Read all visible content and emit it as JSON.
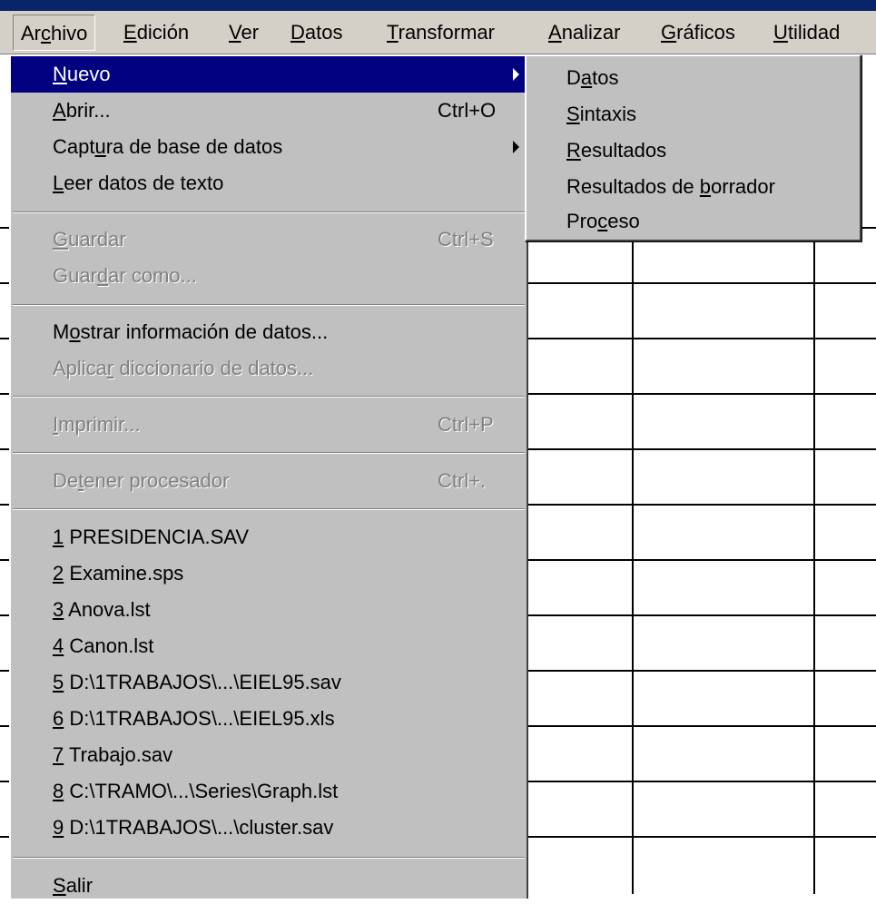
{
  "menubar": {
    "items": [
      {
        "pre": "Ar",
        "key": "c",
        "post": "hivo"
      },
      {
        "pre": "",
        "key": "E",
        "post": "dición"
      },
      {
        "pre": "",
        "key": "V",
        "post": "er"
      },
      {
        "pre": "",
        "key": "D",
        "post": "atos"
      },
      {
        "pre": "",
        "key": "T",
        "post": "ransformar"
      },
      {
        "pre": "",
        "key": "A",
        "post": "nalizar"
      },
      {
        "pre": "",
        "key": "G",
        "post": "ráficos"
      },
      {
        "pre": "",
        "key": "U",
        "post": "tilidad"
      }
    ]
  },
  "file_menu": {
    "nuevo": {
      "pre": "",
      "key": "N",
      "post": "uevo"
    },
    "abrir": {
      "pre": "",
      "key": "A",
      "post": "brir...",
      "shortcut": "Ctrl+O"
    },
    "captura": {
      "pre": "Capt",
      "key": "u",
      "post": "ra de base de datos"
    },
    "leer": {
      "pre": "",
      "key": "L",
      "post": "eer datos de texto"
    },
    "guardar": {
      "pre": "",
      "key": "G",
      "post": "uardar",
      "shortcut": "Ctrl+S"
    },
    "guardar_como": {
      "pre": "Guar",
      "key": "d",
      "post": "ar como..."
    },
    "mostrar": {
      "pre": "M",
      "key": "o",
      "post": "strar información de datos..."
    },
    "aplicar": {
      "pre": "Aplica",
      "key": "r",
      "post": " diccionario de datos..."
    },
    "imprimir": {
      "pre": "",
      "key": "I",
      "post": "mprimir...",
      "shortcut": "Ctrl+P"
    },
    "detener": {
      "pre": "De",
      "key": "t",
      "post": "ener procesador",
      "shortcut": "Ctrl+."
    },
    "recent": [
      {
        "key": "1",
        "text": " PRESIDENCIA.SAV"
      },
      {
        "key": "2",
        "text": " Examine.sps"
      },
      {
        "key": "3",
        "text": " Anova.lst"
      },
      {
        "key": "4",
        "text": " Canon.lst"
      },
      {
        "key": "5",
        "text": " D:\\1TRABAJOS\\...\\EIEL95.sav"
      },
      {
        "key": "6",
        "text": " D:\\1TRABAJOS\\...\\EIEL95.xls"
      },
      {
        "key": "7",
        "text": " Trabajo.sav"
      },
      {
        "key": "8",
        "text": " C:\\TRAMO\\...\\Series\\Graph.lst"
      },
      {
        "key": "9",
        "text": " D:\\1TRABAJOS\\...\\cluster.sav"
      }
    ],
    "salir": {
      "pre": "",
      "key": "S",
      "post": "alir"
    }
  },
  "submenu_nuevo": {
    "items": [
      {
        "pre": "D",
        "key": "a",
        "post": "tos"
      },
      {
        "pre": "",
        "key": "S",
        "post": "intaxis"
      },
      {
        "pre": "",
        "key": "R",
        "post": "esultados"
      },
      {
        "pre": "Resultados de ",
        "key": "b",
        "post": "orrador"
      },
      {
        "pre": "Pro",
        "key": "c",
        "post": "eso"
      }
    ]
  },
  "colors": {
    "menu_bg": "#c0c0c0",
    "highlight": "#000080",
    "disabled_text": "#808080",
    "title_strip": "#0a246a"
  }
}
